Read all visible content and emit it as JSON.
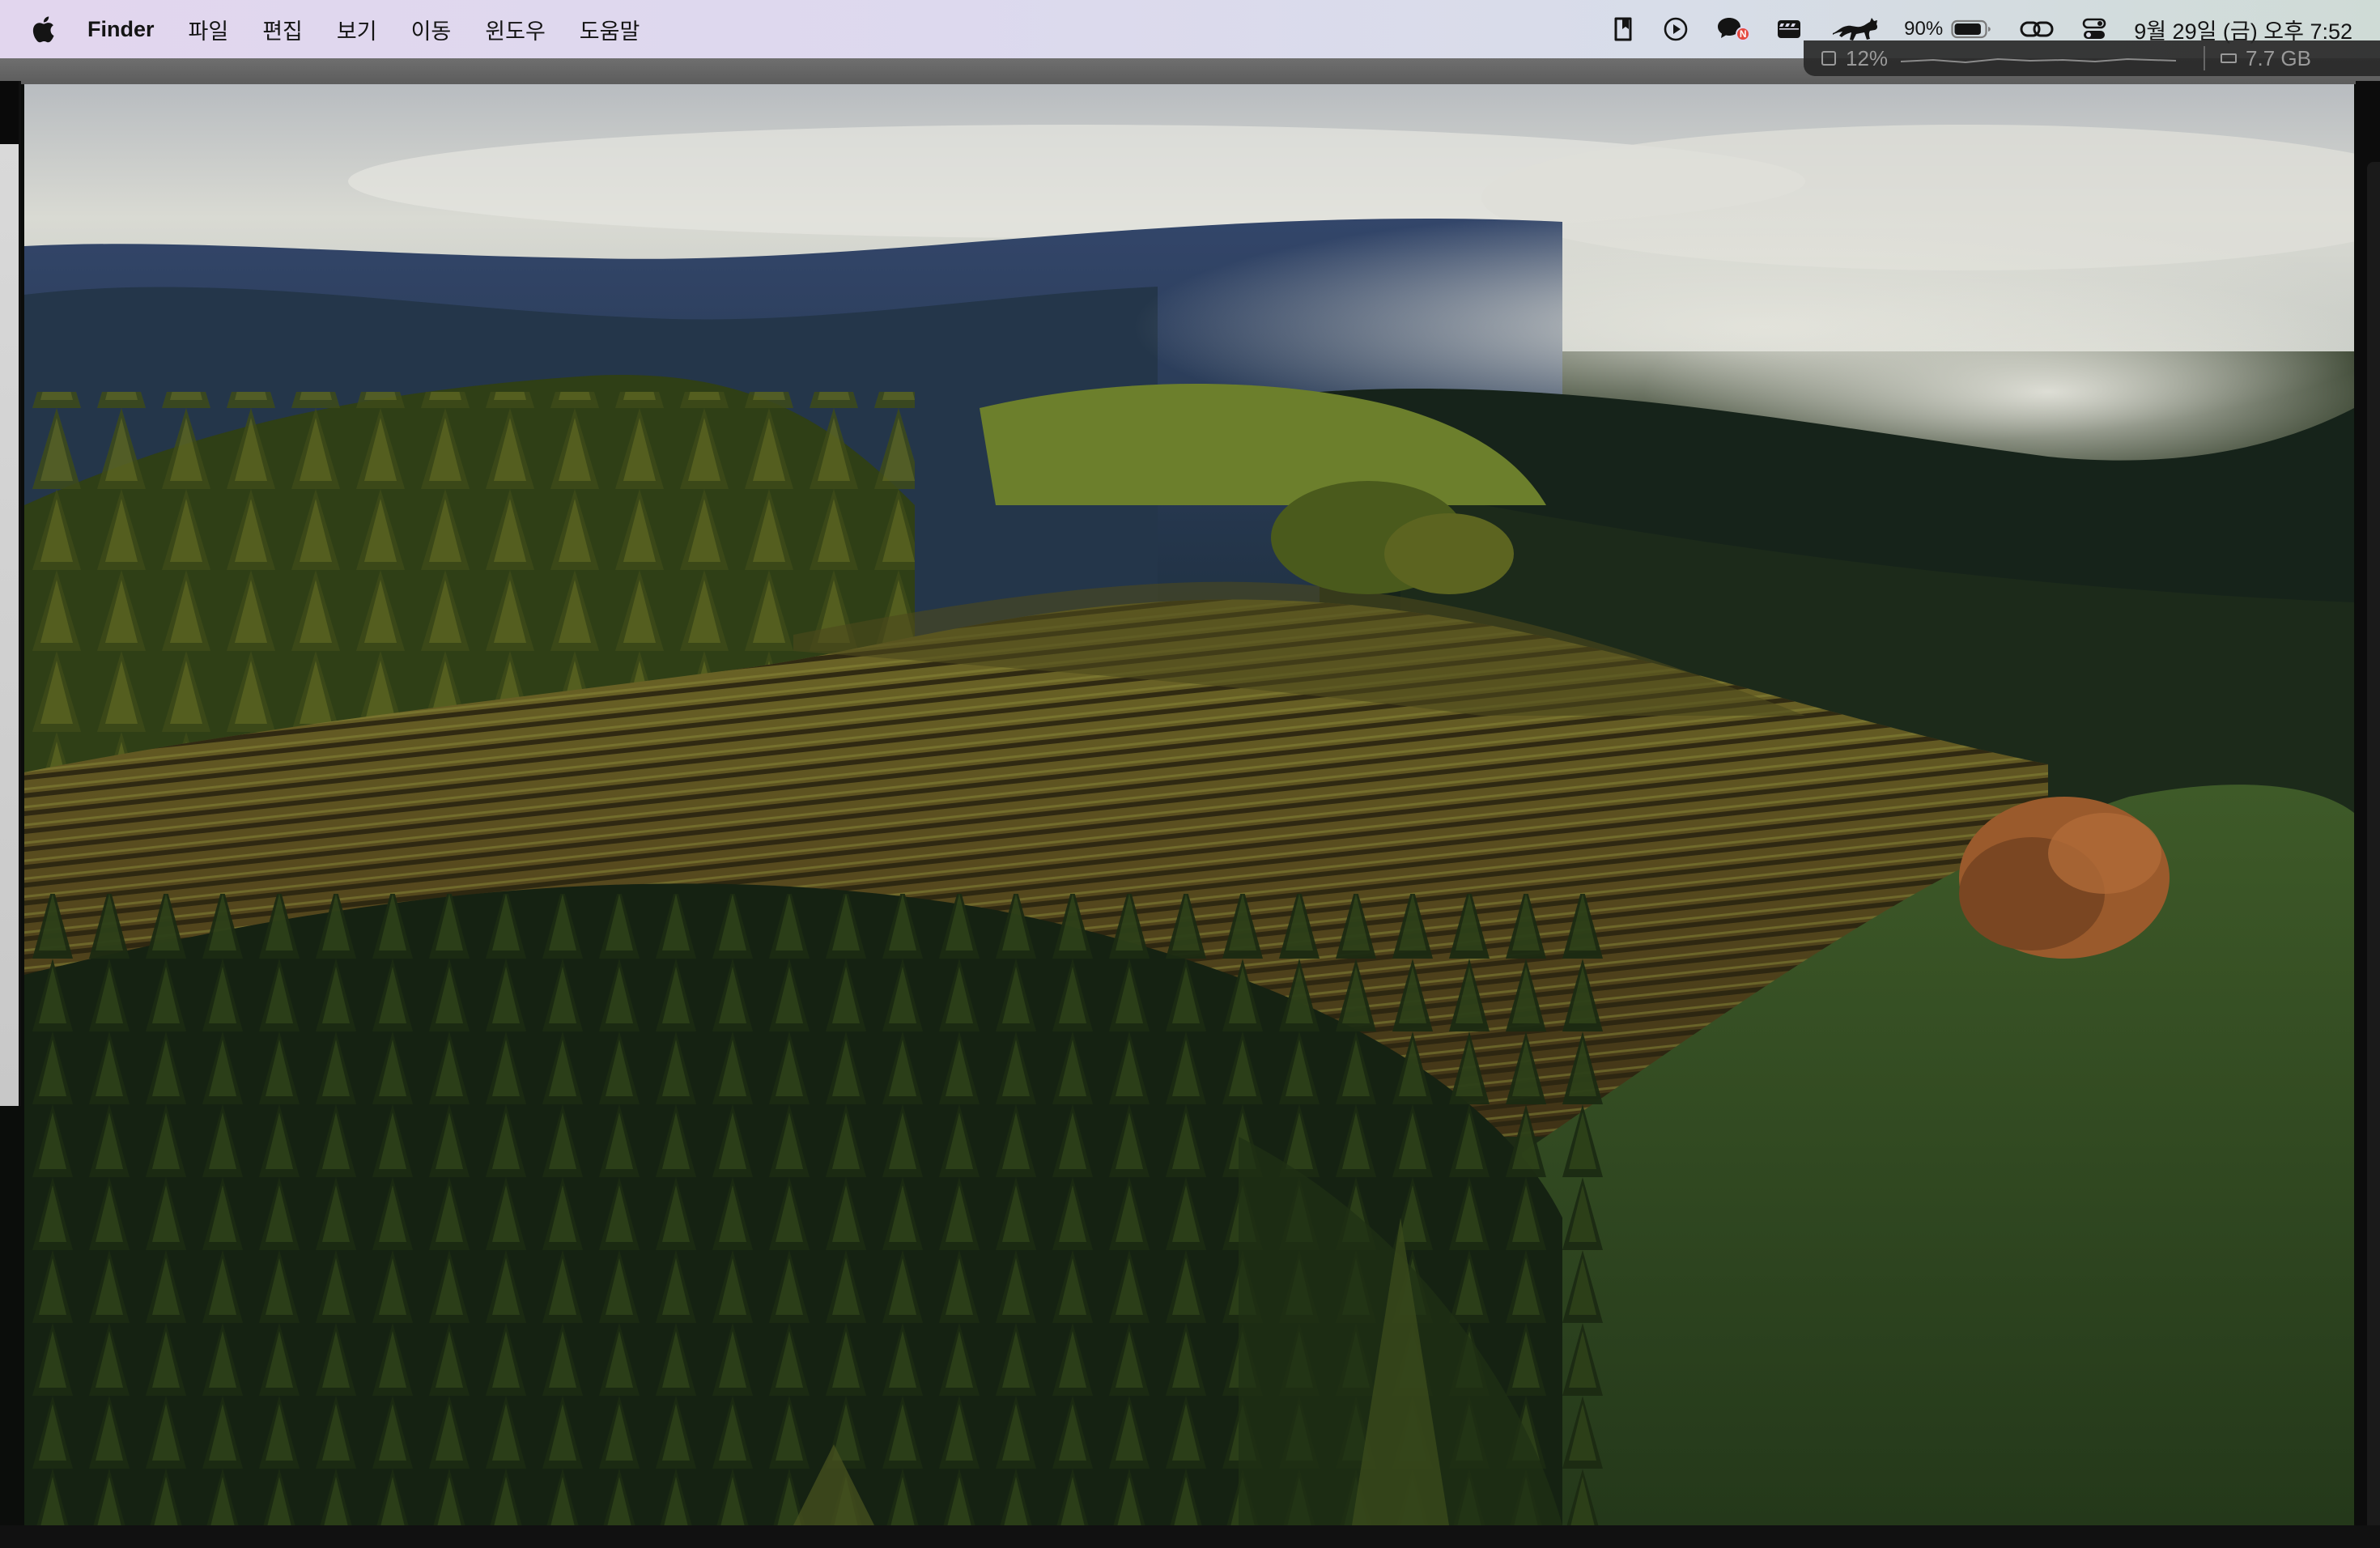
{
  "menubar": {
    "apple_icon": "apple-logo-icon",
    "app_name": "Finder",
    "menus": [
      "파일",
      "편집",
      "보기",
      "이동",
      "윈도우",
      "도움말"
    ],
    "status": {
      "icons": [
        "clipboard-icon",
        "play-icon",
        "chat-bubble-icon",
        "clapper-icon",
        "runcat-icon",
        "battery-icon",
        "link-icon",
        "control-center-icon"
      ],
      "battery_percent": "90%",
      "battery_level": 0.9,
      "datetime": "9월 29일 (금) 오후 7:52",
      "notification_badge": "N",
      "badge_color": "#e5483f"
    }
  },
  "stats_widget": {
    "cpu_label": "12%",
    "memory_label": "7.7 GB"
  },
  "wallpaper": {
    "description_icon": "landscape-wallpaper"
  }
}
